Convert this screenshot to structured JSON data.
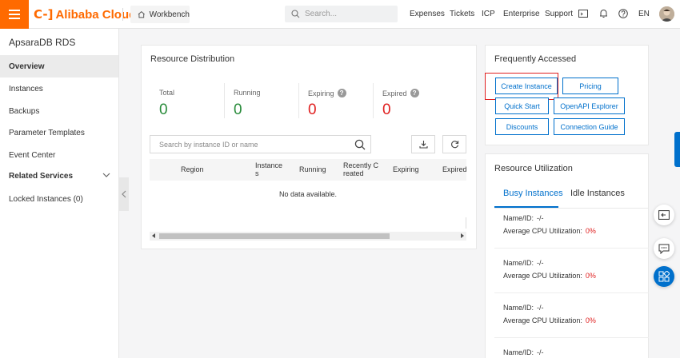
{
  "header": {
    "menu_icon": "hamburger-icon",
    "logo_mark": "C-]",
    "logo_text": "Alibaba Cloud",
    "workbench_label": "Workbench",
    "search_placeholder": "Search...",
    "links": [
      "Expenses",
      "Tickets",
      "ICP",
      "Enterprise",
      "Support"
    ],
    "language": "EN",
    "brand_color": "#ff6a00"
  },
  "sidebar": {
    "title": "ApsaraDB RDS",
    "items": [
      {
        "label": "Overview"
      },
      {
        "label": "Instances"
      },
      {
        "label": "Backups"
      },
      {
        "label": "Parameter Templates"
      },
      {
        "label": "Event Center"
      },
      {
        "label": "Related Services"
      },
      {
        "label": "Locked Instances (0)"
      }
    ]
  },
  "resource_distribution": {
    "title": "Resource Distribution",
    "stats": [
      {
        "label": "Total",
        "value": "0",
        "color": "#2a8c3c"
      },
      {
        "label": "Running",
        "value": "0",
        "color": "#2a8c3c"
      },
      {
        "label": "Expiring",
        "value": "0",
        "color": "#e02020"
      },
      {
        "label": "Expired",
        "value": "0",
        "color": "#e02020"
      }
    ],
    "search_placeholder": "Search by instance ID or name",
    "columns": [
      "Region",
      "Instances",
      "Running",
      "Recently Created",
      "Expiring",
      "Expired"
    ],
    "columns_wrapped": {
      "instances_1": "Instance",
      "instances_2": "s",
      "recent_1": "Recently C",
      "recent_2": "reated"
    },
    "empty_text": "No data available."
  },
  "frequently_accessed": {
    "title": "Frequently Accessed",
    "buttons": [
      "Create Instance",
      "Pricing",
      "Quick Start",
      "OpenAPI Explorer",
      "Discounts",
      "Connection Guide"
    ],
    "accent": "#0070cc"
  },
  "resource_utilization": {
    "title": "Resource Utilization",
    "tabs": [
      "Busy Instances",
      "Idle Instances"
    ],
    "rows": [
      {
        "name_label": "Name/ID:",
        "name_value": "-/-",
        "cpu_label": "Average CPU Utilization:",
        "cpu_value": "0%"
      },
      {
        "name_label": "Name/ID:",
        "name_value": "-/-",
        "cpu_label": "Average CPU Utilization:",
        "cpu_value": "0%"
      },
      {
        "name_label": "Name/ID:",
        "name_value": "-/-",
        "cpu_label": "Average CPU Utilization:",
        "cpu_value": "0%"
      },
      {
        "name_label": "Name/ID:",
        "name_value": "-/-"
      }
    ]
  }
}
